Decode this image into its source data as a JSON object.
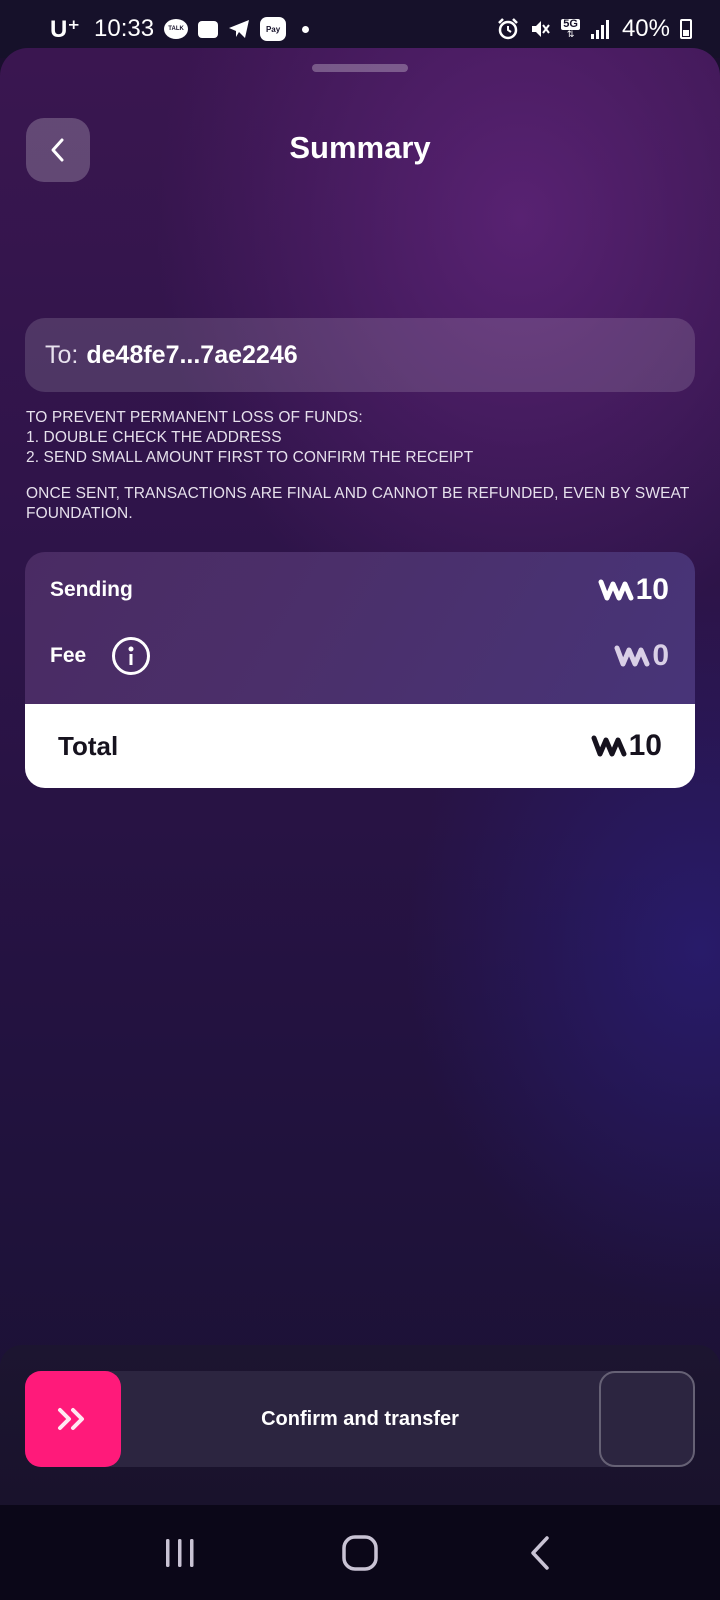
{
  "status_bar": {
    "carrier": "U⁺",
    "time": "10:33",
    "talk_badge": "TALK",
    "pay_badge": "Pay",
    "network": "5G",
    "battery": "40%"
  },
  "header": {
    "title": "Summary"
  },
  "recipient": {
    "prefix": "To:",
    "address": "de48fe7...7ae2246"
  },
  "warning": {
    "lines": [
      "TO PREVENT PERMANENT LOSS OF FUNDS:",
      "1. DOUBLE CHECK THE ADDRESS",
      "2. SEND SMALL AMOUNT FIRST TO CONFIRM THE RECEIPT"
    ],
    "final_note": "ONCE SENT, TRANSACTIONS ARE FINAL AND CANNOT BE REFUNDED, EVEN BY SWEAT FOUNDATION."
  },
  "summary": {
    "sending_label": "Sending",
    "sending_amount": "10",
    "fee_label": "Fee",
    "fee_amount": "0",
    "total_label": "Total",
    "total_amount": "10",
    "currency_icon": "sweat-coin-icon"
  },
  "action": {
    "slider_label": "Confirm and transfer",
    "accent_color": "#ff1a7a"
  }
}
